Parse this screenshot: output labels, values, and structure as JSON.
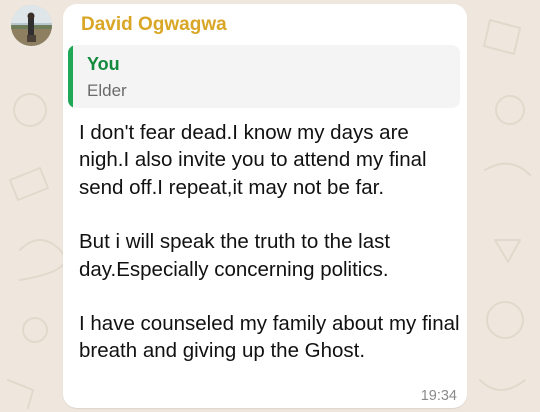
{
  "colors": {
    "wallpaper": "#efe7dd",
    "bubble": "#ffffff",
    "sender_name": "#d9a626",
    "quote_bar": "#1fa855",
    "quote_author": "#138a3e"
  },
  "avatar": {
    "icon": "contact-photo"
  },
  "message": {
    "sender": "David Ogwagwa",
    "quoted": {
      "author": "You",
      "text": "Elder"
    },
    "paragraphs": [
      "I don't fear dead.I know my days are nigh.I also invite you to attend my final send off.I repeat,it may not be far.",
      "But i will speak the truth to the last day.Especially concerning politics.",
      "I have counseled my family about my final breath and giving up the Ghost."
    ],
    "time": "19:34"
  }
}
